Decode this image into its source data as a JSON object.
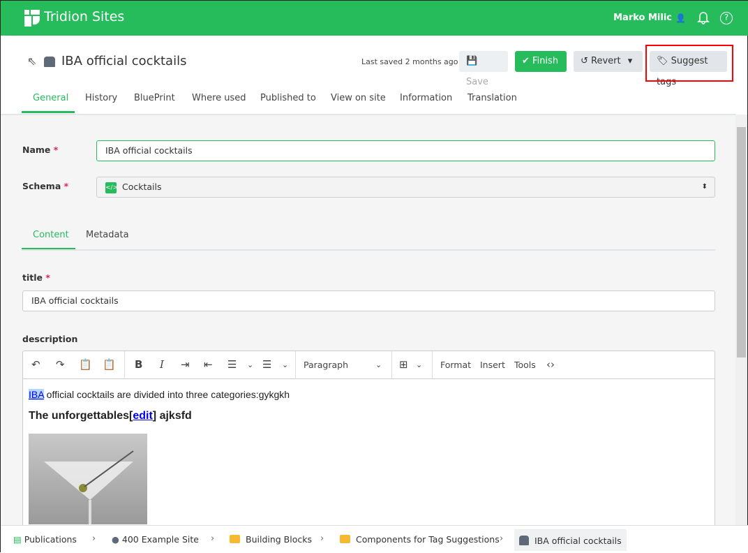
{
  "header": {
    "brand": "Tridion Sites",
    "user": "Marko Milic"
  },
  "item": {
    "title": "IBA official cocktails",
    "last_saved": "Last saved 2 months ago"
  },
  "actions": {
    "save": "Save",
    "finish": "Finish",
    "revert": "Revert",
    "suggest_tags": "Suggest tags"
  },
  "tabs": [
    "General",
    "History",
    "BluePrint",
    "Where used",
    "Published to",
    "View on site",
    "Information",
    "Translation"
  ],
  "form": {
    "name_label": "Name",
    "name_value": "IBA official cocktails",
    "schema_label": "Schema",
    "schema_value": "Cocktails",
    "required": "*"
  },
  "content_tabs": [
    "Content",
    "Metadata"
  ],
  "fields": {
    "title_label": "title",
    "title_value": "IBA official cocktails",
    "description_label": "description"
  },
  "editor": {
    "block_format": "Paragraph",
    "menus": [
      "Format",
      "Insert",
      "Tools"
    ],
    "para_link": "IBA",
    "para_text": " official cocktails are divided into three categories:gykgkh",
    "heading_text": "The unforgettables[",
    "heading_link": "edit",
    "heading_tail": "] ajksfd"
  },
  "breadcrumb": [
    "Publications",
    "400 Example Site",
    "Building Blocks",
    "Components for Tag Suggestions",
    "IBA official cocktails"
  ]
}
